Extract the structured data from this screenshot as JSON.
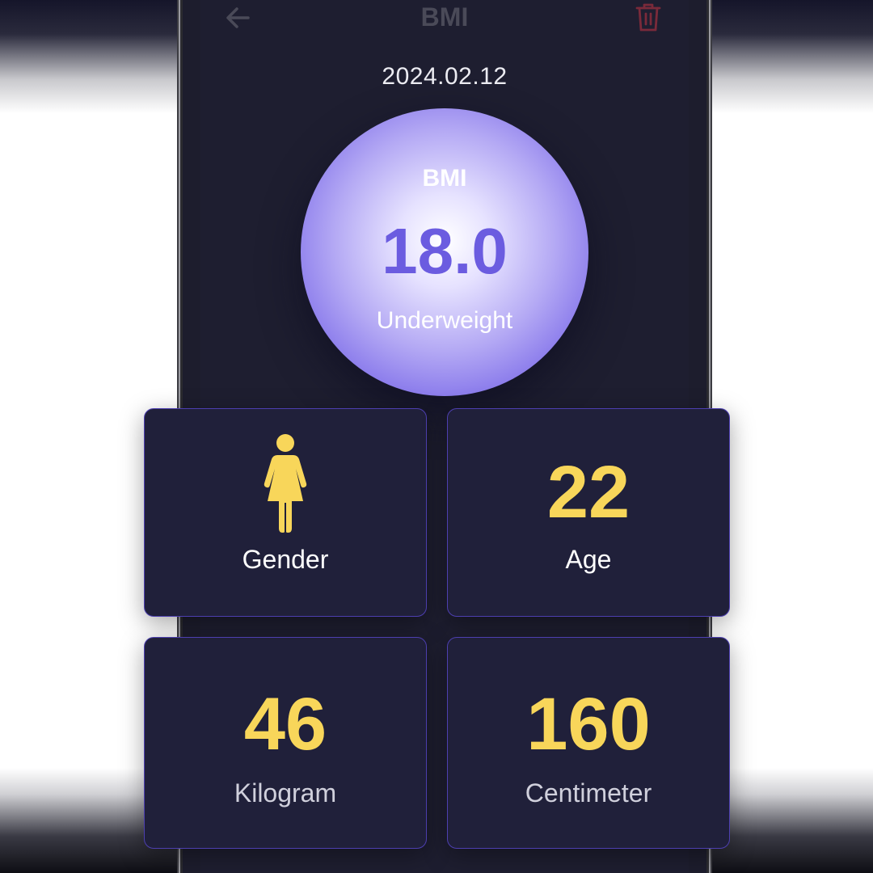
{
  "header": {
    "title": "BMI",
    "back_icon": "arrow-left-icon",
    "delete_icon": "trash-icon"
  },
  "record": {
    "date": "2024.02.12"
  },
  "bmi": {
    "label": "BMI",
    "value": "18.0",
    "status": "Underweight"
  },
  "cards": {
    "gender": {
      "icon": "female-icon",
      "label": "Gender"
    },
    "age": {
      "value": "22",
      "label": "Age"
    },
    "weight": {
      "value": "46",
      "label": "Kilogram"
    },
    "height": {
      "value": "160",
      "label": "Centimeter"
    }
  },
  "colors": {
    "background": "#1e1e30",
    "accent": "#6b5ce0",
    "highlight": "#f8d65a",
    "card_border": "#4d3fb0",
    "delete": "#e0455a"
  }
}
